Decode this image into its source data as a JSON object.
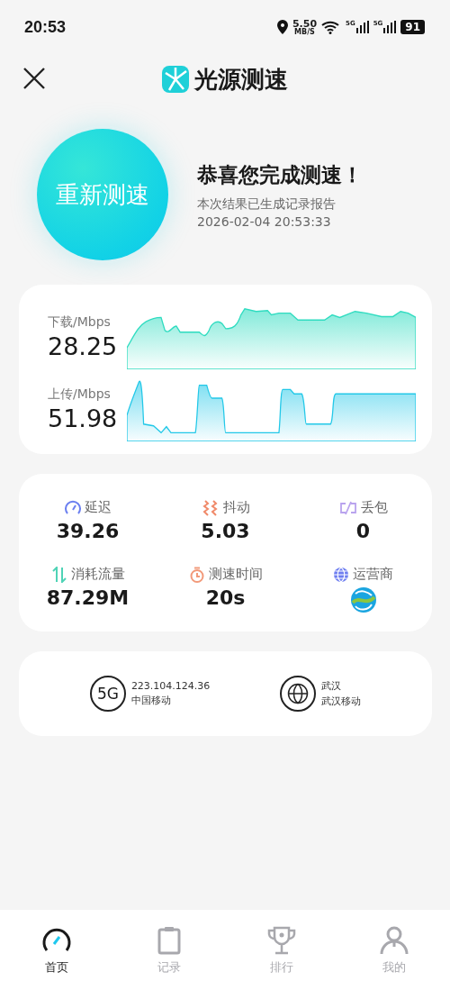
{
  "status_bar": {
    "time": "20:53",
    "net_speed": "5.50",
    "net_unit": "MB/S",
    "sim_1": "5G",
    "sim_2": "5G",
    "battery": "91"
  },
  "header": {
    "title": "光源测速"
  },
  "hero": {
    "button": "重新测速",
    "headline": "恭喜您完成测速！",
    "subtitle": "本次结果已生成记录报告",
    "timestamp": "2026-02-04 20:53:33"
  },
  "speeds": [
    {
      "kind": "download",
      "label": "下载/Mbps",
      "value": "28.25"
    },
    {
      "kind": "upload",
      "label": "上传/Mbps",
      "value": "51.98"
    }
  ],
  "metrics": [
    {
      "kind": "latency",
      "label": "延迟",
      "value": "39.26"
    },
    {
      "kind": "jitter",
      "label": "抖动",
      "value": "5.03"
    },
    {
      "kind": "loss",
      "label": "丢包",
      "value": "0"
    },
    {
      "kind": "traffic",
      "label": "消耗流量",
      "value": "87.29M"
    },
    {
      "kind": "duration",
      "label": "测速时间",
      "value": "20s"
    },
    {
      "kind": "operator",
      "label": "运营商"
    }
  ],
  "network": [
    {
      "kind": "cellular",
      "badge": "5G",
      "line_1": "223.104.124.36",
      "line_2": "中国移动"
    },
    {
      "kind": "globe",
      "line_1": "武汉",
      "line_2": "武汉移动"
    }
  ],
  "tabs": [
    {
      "kind": "home",
      "label": "首页",
      "selected": true
    },
    {
      "kind": "records",
      "label": "记录",
      "selected": false
    },
    {
      "kind": "ranking",
      "label": "排行",
      "selected": false
    },
    {
      "kind": "me",
      "label": "我的",
      "selected": false
    }
  ]
}
